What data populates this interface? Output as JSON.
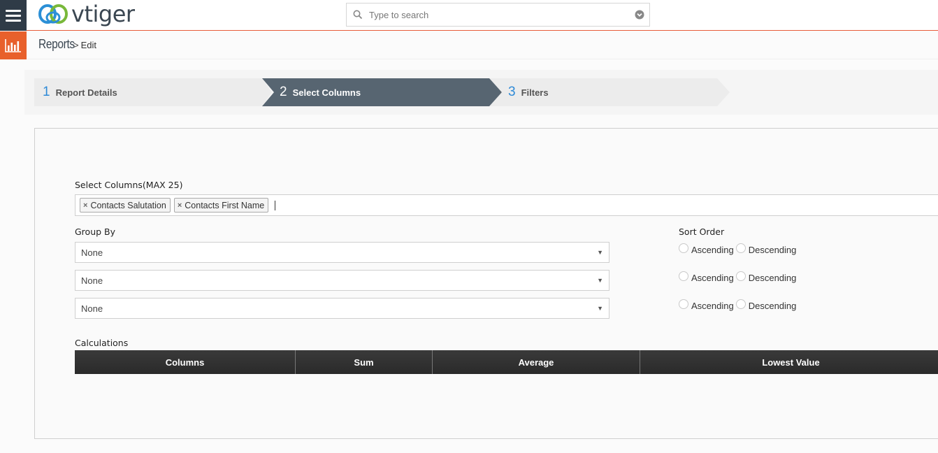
{
  "app": {
    "logo_text": "vtiger"
  },
  "search": {
    "placeholder": "Type to search"
  },
  "breadcrumb": {
    "module": "Reports",
    "separator": ">",
    "page": "Edit"
  },
  "steps": [
    {
      "number": "1",
      "label": "Report Details",
      "active": false
    },
    {
      "number": "2",
      "label": "Select Columns",
      "active": true
    },
    {
      "number": "3",
      "label": "Filters",
      "active": false
    }
  ],
  "select_columns": {
    "label": "Select Columns(MAX 25)",
    "tags": [
      "Contacts Salutation",
      "Contacts First Name"
    ],
    "remove_glyph": "×"
  },
  "group_by": {
    "label": "Group By",
    "selects": [
      "None",
      "None",
      "None"
    ]
  },
  "sort_order": {
    "label": "Sort Order",
    "options": [
      "Ascending",
      "Descending"
    ]
  },
  "calculations": {
    "label": "Calculations",
    "columns": [
      "Columns",
      "Sum",
      "Average",
      "Lowest Value"
    ]
  },
  "colors": {
    "accent": "#e8602b",
    "nav_dark": "#2f3b47",
    "active_step": "#576571",
    "step_bg": "#ececec",
    "step_number": "#2e8ad7"
  },
  "icons": {
    "menu": "hamburger-icon",
    "logo": "vtiger-logo-icon",
    "search": "search-icon",
    "search_dropdown": "chevron-down-circle-icon",
    "module": "bar-chart-icon"
  }
}
